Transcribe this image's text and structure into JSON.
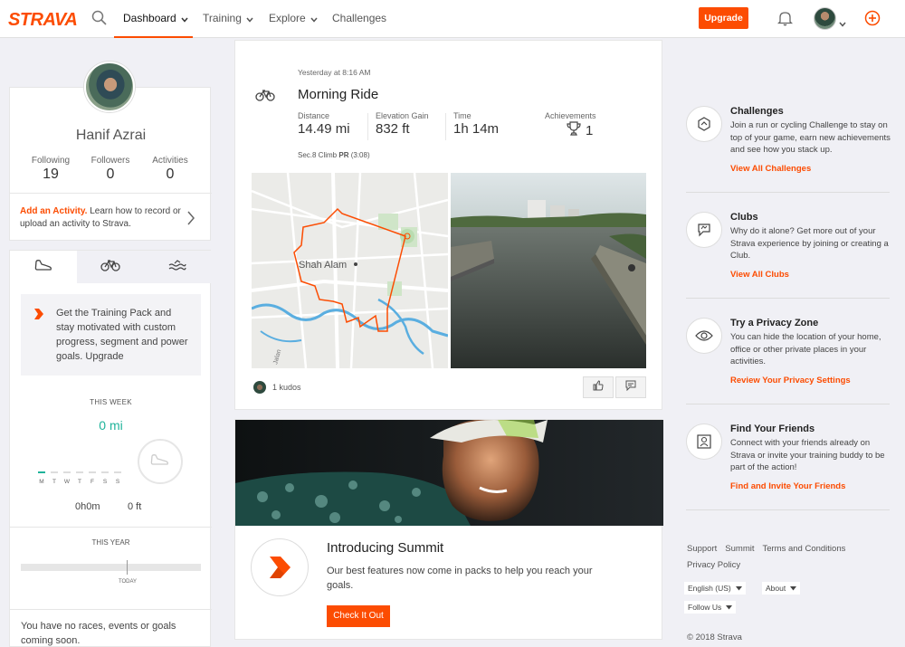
{
  "brand": {
    "logo": "STRAVA",
    "accent": "#fc4c02",
    "teal": "#1fb39a"
  },
  "nav": {
    "items": [
      {
        "label": "Dashboard",
        "active": true,
        "has_caret": true
      },
      {
        "label": "Training",
        "active": false,
        "has_caret": true
      },
      {
        "label": "Explore",
        "active": false,
        "has_caret": true
      },
      {
        "label": "Challenges",
        "active": false,
        "has_caret": false
      }
    ],
    "upgrade_label": "Upgrade",
    "icons": [
      "search-icon",
      "bell-icon",
      "avatar",
      "plus-circle-icon"
    ]
  },
  "profile": {
    "name": "Hanif Azrai",
    "stats": [
      {
        "label": "Following",
        "value": "19"
      },
      {
        "label": "Followers",
        "value": "0"
      },
      {
        "label": "Activities",
        "value": "0"
      }
    ],
    "add_activity_bold": "Add an Activity.",
    "add_activity_text": " Learn how to record or upload an activity to Strava."
  },
  "training": {
    "tabs": [
      "run-shoe-icon",
      "bike-icon",
      "swim-icon"
    ],
    "pack_text": "Get the Training Pack and stay motivated with custom progress, segment and power goals. Upgrade",
    "this_week_label": "THIS WEEK",
    "this_week_value": "0 mi",
    "days": [
      "M",
      "T",
      "W",
      "T",
      "F",
      "S",
      "S"
    ],
    "time": "0h0m",
    "elevation": "0 ft",
    "this_year_label": "THIS YEAR",
    "today_label": "TODAY",
    "no_races": "You have no races, events or goals coming soon."
  },
  "activity": {
    "time": "Yesterday at 8:16 AM",
    "title": "Morning Ride",
    "metrics": [
      {
        "label": "Distance",
        "value": "14.49 mi"
      },
      {
        "label": "Elevation Gain",
        "value": "832 ft"
      },
      {
        "label": "Time",
        "value": "1h 14m"
      }
    ],
    "achievements_label": "Achievements",
    "achievements_value": "1",
    "segment_name": "Sec.8 Climb",
    "segment_pr": "PR",
    "segment_time": "(3:08)",
    "map_city": "Shah Alam",
    "map_street": "Jalan",
    "kudos": "1 kudos"
  },
  "summit": {
    "title": "Introducing Summit",
    "body": "Our best features now come in packs to help you reach your goals.",
    "button": "Check It Out"
  },
  "sidebar": [
    {
      "title": "Challenges",
      "body": "Join a run or cycling Challenge to stay on top of your game, earn new achievements and see how you stack up.",
      "link": "View All Challenges",
      "icon": "challenge-hex-icon"
    },
    {
      "title": "Clubs",
      "body": "Why do it alone? Get more out of your Strava experience by joining or creating a Club.",
      "link": "View All Clubs",
      "icon": "club-flag-icon"
    },
    {
      "title": "Try a Privacy Zone",
      "body": "You can hide the location of your home, office or other private places in your activities.",
      "link": "Review Your Privacy Settings",
      "icon": "eye-icon"
    },
    {
      "title": "Find Your Friends",
      "body": "Connect with your friends already on Strava or invite your training buddy to be part of the action!",
      "link": "Find and Invite Your Friends",
      "icon": "person-card-icon"
    }
  ],
  "footer": {
    "links": [
      "Support",
      "Summit",
      "Terms and Conditions",
      "Privacy Policy"
    ],
    "language": "English (US)",
    "about": "About",
    "follow_us": "Follow Us",
    "copyright": "© 2018 Strava"
  }
}
